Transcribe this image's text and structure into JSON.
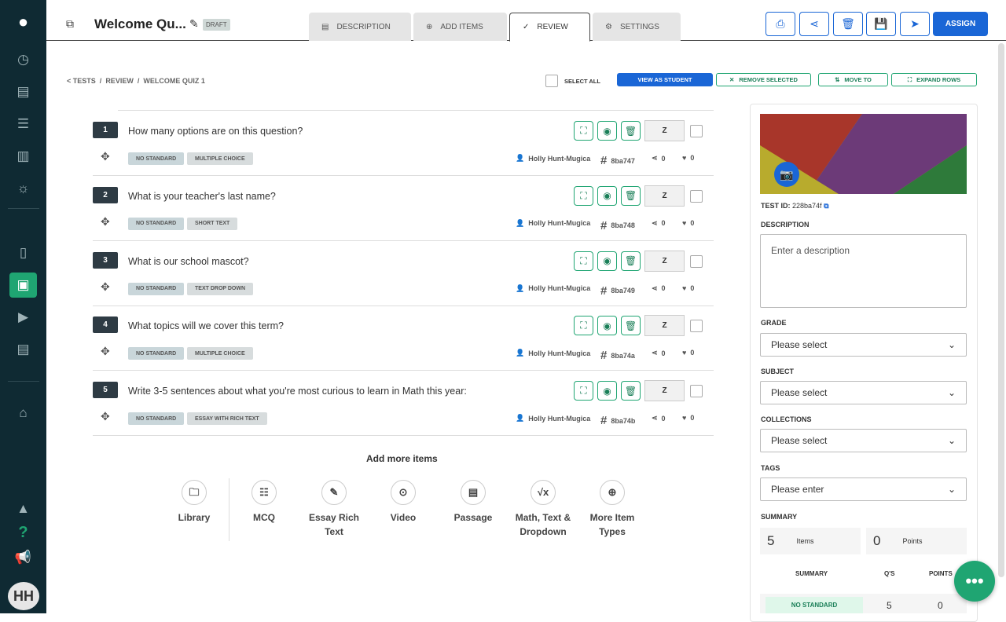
{
  "header": {
    "title": "Welcome Qu...",
    "status": "DRAFT",
    "tabs": [
      {
        "label": "DESCRIPTION"
      },
      {
        "label": "ADD ITEMS"
      },
      {
        "label": "REVIEW"
      },
      {
        "label": "SETTINGS"
      }
    ],
    "assign_label": "ASSIGN"
  },
  "breadcrumb": {
    "tests": "< TESTS",
    "review": "REVIEW",
    "current": "WELCOME QUIZ 1",
    "sep": "/"
  },
  "toolbar": {
    "select_all": "SELECT ALL",
    "view_as_student": "VIEW AS STUDENT",
    "remove_selected": "REMOVE SELECTED",
    "move_to": "MOVE TO",
    "expand_rows": "EXPAND ROWS"
  },
  "questions": [
    {
      "num": "1",
      "text": "How many options are on this question?",
      "standard": "NO STANDARD",
      "type": "MULTIPLE CHOICE",
      "points": "Z",
      "author": "Holly Hunt-Mugica",
      "id": "8ba747",
      "shares": "0",
      "likes": "0"
    },
    {
      "num": "2",
      "text": "What is your teacher's last name?",
      "standard": "NO STANDARD",
      "type": "SHORT TEXT",
      "points": "Z",
      "author": "Holly Hunt-Mugica",
      "id": "8ba748",
      "shares": "0",
      "likes": "0"
    },
    {
      "num": "3",
      "text": "What is our school mascot?",
      "standard": "NO STANDARD",
      "type": "TEXT DROP DOWN",
      "points": "Z",
      "author": "Holly Hunt-Mugica",
      "id": "8ba749",
      "shares": "0",
      "likes": "0"
    },
    {
      "num": "4",
      "text": "What topics will we cover this term?",
      "standard": "NO STANDARD",
      "type": "MULTIPLE CHOICE",
      "points": "Z",
      "author": "Holly Hunt-Mugica",
      "id": "8ba74a",
      "shares": "0",
      "likes": "0"
    },
    {
      "num": "5",
      "text": "Write 3-5 sentences about what you're most curious to learn in Math this year:",
      "standard": "NO STANDARD",
      "type": "ESSAY WITH RICH TEXT",
      "points": "Z",
      "author": "Holly Hunt-Mugica",
      "id": "8ba74b",
      "shares": "0",
      "likes": "0"
    }
  ],
  "add_more": {
    "title": "Add more items",
    "items": [
      {
        "label": "Library",
        "icon": "folder"
      },
      {
        "label": "MCQ",
        "icon": "list"
      },
      {
        "label": "Essay Rich Text",
        "icon": "pen"
      },
      {
        "label": "Video",
        "icon": "play"
      },
      {
        "label": "Passage",
        "icon": "doc"
      },
      {
        "label": "Math, Text & Dropdown",
        "icon": "sqrt"
      },
      {
        "label": "More Item Types",
        "icon": "plus"
      }
    ]
  },
  "panel": {
    "test_id_label": "TEST ID:",
    "test_id": "228ba74f",
    "description_label": "DESCRIPTION",
    "description_placeholder": "Enter a description",
    "grade_label": "GRADE",
    "grade_value": "Please select",
    "subject_label": "SUBJECT",
    "subject_value": "Please select",
    "collections_label": "COLLECTIONS",
    "collections_value": "Please select",
    "tags_label": "TAGS",
    "tags_value": "Please enter",
    "summary_label": "SUMMARY",
    "items_count": "5",
    "items_label": "Items",
    "points_count": "0",
    "points_label": "Points",
    "table": {
      "col1": "SUMMARY",
      "col2": "Q'S",
      "col3": "POINTS",
      "row_standard": "NO STANDARD",
      "row_qs": "5",
      "row_points": "0"
    }
  },
  "user": {
    "initials": "HH"
  },
  "colors": {
    "accent": "#1fa572",
    "primary": "#1a66d6",
    "sidebar": "#0f2a33"
  }
}
